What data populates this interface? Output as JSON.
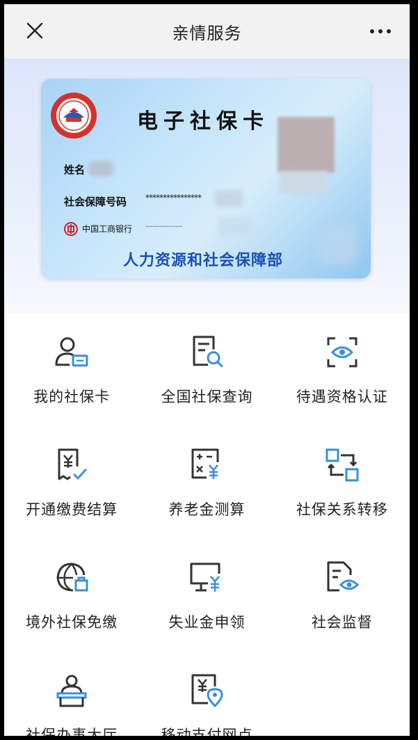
{
  "header": {
    "title": "亲情服务",
    "close_icon": "close-icon",
    "more_icon": "more-icon"
  },
  "card": {
    "title": "电子社保卡",
    "name_label": "姓名",
    "number_label": "社会保障号码",
    "number_masked": "****************",
    "bank_name": "中国工商银行",
    "bank_masked": "·····················",
    "issuer": "人力资源和社会保障部"
  },
  "services": [
    {
      "label": "我的社保卡",
      "icon": "user-card-icon"
    },
    {
      "label": "全国社保查询",
      "icon": "doc-search-icon"
    },
    {
      "label": "待遇资格认证",
      "icon": "eye-scan-icon"
    },
    {
      "label": "开通缴费结算",
      "icon": "bill-check-icon"
    },
    {
      "label": "养老金测算",
      "icon": "calculator-icon"
    },
    {
      "label": "社保关系转移",
      "icon": "transfer-icon"
    },
    {
      "label": "境外社保免缴",
      "icon": "globe-icon"
    },
    {
      "label": "失业金申领",
      "icon": "monitor-yuan-icon"
    },
    {
      "label": "社会监督",
      "icon": "doc-eye-icon"
    },
    {
      "label": "社保办事大厅",
      "icon": "service-hall-icon"
    },
    {
      "label": "移动支付网点",
      "icon": "payment-location-icon"
    }
  ],
  "colors": {
    "accent": "#3a8fd6",
    "dark": "#333333",
    "issuer_blue": "#1b4fb5",
    "emblem_red": "#d4322c"
  }
}
